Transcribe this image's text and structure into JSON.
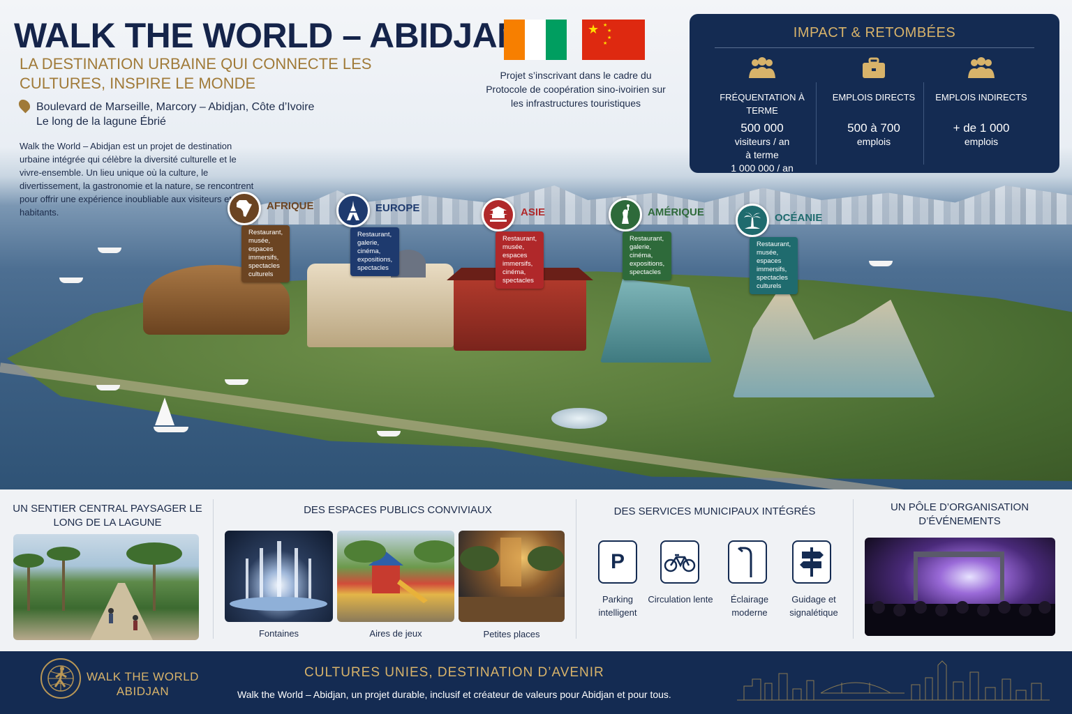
{
  "header": {
    "title": "WALK THE WORLD – ABIDJAN",
    "subtitle": "LA DESTINATION URBAINE QUI CONNECTE LES CULTURES, INSPIRE LE MONDE",
    "address_line1": "Boulevard de Marseille, Marcory – Abidjan, Côte d’Ivoire",
    "address_line2": "Le long de la lagune Ébrié",
    "intro": "Walk the World – Abidjan est un projet de destination urbaine intégrée qui célèbre la diversité culturelle et le vivre-ensemble. Un lieu unique où la culture, le divertissement, la gastronomie et la nature, se rencontrent pour offrir une expérience inoubliable aux visiteurs et aux habitants."
  },
  "cooperation": {
    "text": "Projet s’inscrivant dans le cadre du Protocole de coopération sino-ivoirien sur les infrastructures touristiques",
    "flags": [
      "flag-cote-divoire",
      "flag-china"
    ]
  },
  "impact": {
    "title": "IMPACT & RETOMBÉES",
    "items": [
      {
        "icon": "people-icon",
        "label": "FRÉQUENTATION À TERME",
        "value": "500 000",
        "unit": "visiteurs / an",
        "extra": "à terme",
        "extra2": "1 000 000 / an"
      },
      {
        "icon": "briefcase-icon",
        "label": "EMPLOIS DIRECTS",
        "value": "500 à 700",
        "unit": "emplois"
      },
      {
        "icon": "people-icon",
        "label": "EMPLOIS INDIRECTS",
        "value": "+ de 1 000",
        "unit": "emplois"
      }
    ]
  },
  "continents": [
    {
      "name": "AFRIQUE",
      "desc": "Restaurant, musée,\nespaces immersifs,\nspectacles culturels",
      "color": "#6b4422",
      "icon": "africa-icon"
    },
    {
      "name": "EUROPE",
      "desc": "Restaurant, galerie,\ncinéma, expositions,\nspectacles",
      "color": "#1e3a6e",
      "icon": "eiffel-tower-icon"
    },
    {
      "name": "ASIE",
      "desc": "Restaurant, musée,\nespaces immersifs,\ncinéma, spectacles",
      "color": "#b0282a",
      "icon": "pagoda-icon"
    },
    {
      "name": "AMÉRIQUE",
      "desc": "Restaurant, galerie,\ncinéma, expositions,\nspectacles",
      "color": "#2e6a3a",
      "icon": "statue-of-liberty-icon"
    },
    {
      "name": "OCÉANIE",
      "desc": "Restaurant, musée,\nespaces immersifs,\nspectacles culturels",
      "color": "#1f6b6e",
      "icon": "palm-tree-icon"
    }
  ],
  "sections": {
    "path": {
      "title": "UN SENTIER CENTRAL PAYSAGER LE LONG DE LA LAGUNE"
    },
    "public": {
      "title": "DES ESPACES PUBLICS CONVIVIAUX",
      "items": [
        "Fontaines",
        "Aires de jeux",
        "Petites places"
      ]
    },
    "services": {
      "title": "DES SERVICES MUNICIPAUX INTÉGRÉS",
      "items": [
        {
          "icon": "parking-icon",
          "label": "Parking intelligent"
        },
        {
          "icon": "bicycle-icon",
          "label": "Circulation lente"
        },
        {
          "icon": "streetlight-icon",
          "label": "Éclairage moderne"
        },
        {
          "icon": "signpost-icon",
          "label": "Guidage et signalétique"
        }
      ]
    },
    "events": {
      "title": "UN PÔLE D’ORGANISATION D’ÉVÉNEMENTS"
    }
  },
  "footer": {
    "brand_line1": "WALK THE WORLD",
    "brand_line2": "ABIDJAN",
    "slogan": "CULTURES UNIES, DESTINATION D’AVENIR",
    "text": "Walk the World – Abidjan, un projet durable, inclusif et créateur de valeurs pour Abidjan et pour tous."
  },
  "colors": {
    "navy": "#142b52",
    "gold": "#d8b36a",
    "gold_dark": "#a07a38"
  }
}
